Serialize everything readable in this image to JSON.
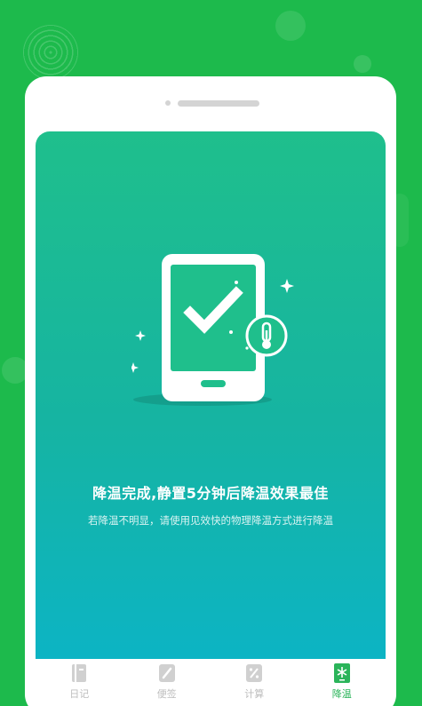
{
  "screen": {
    "title": "降温完成,静置5分钟后降温效果最佳",
    "subtitle": "若降温不明显，请使用见效快的物理降温方式进行降温"
  },
  "tabs": [
    {
      "label": "日记",
      "icon": "diary-icon",
      "active": false
    },
    {
      "label": "便签",
      "icon": "note-pen-icon",
      "active": false
    },
    {
      "label": "计算",
      "icon": "calculator-icon",
      "active": false
    },
    {
      "label": "降温",
      "icon": "cooling-icon",
      "active": true
    }
  ],
  "colors": {
    "background": "#1dba4c",
    "screen_gradient_top": "#1fbf8c",
    "screen_gradient_bottom": "#0cb4c4",
    "tab_active": "#2bb45a",
    "tab_inactive": "#bdbdbd"
  }
}
